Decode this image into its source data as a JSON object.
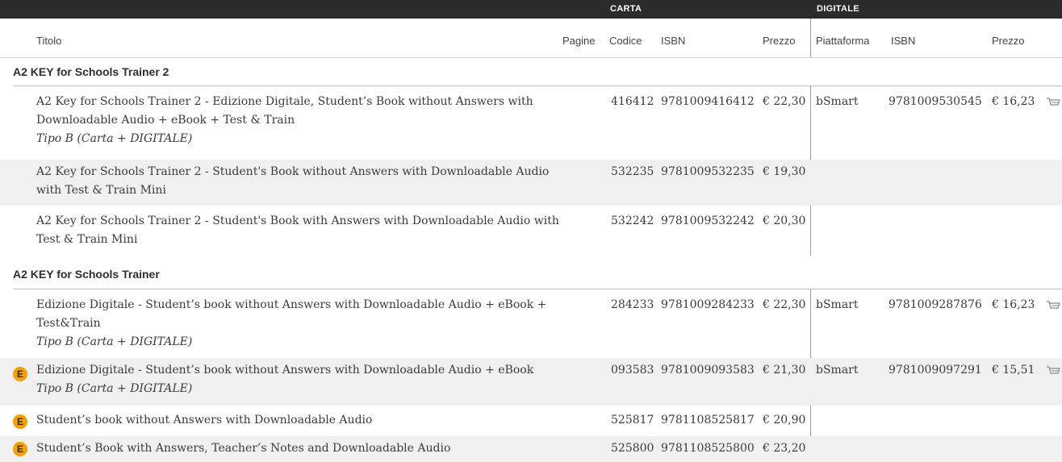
{
  "topbar": {
    "carta": "CARTA",
    "digitale": "DIGITALE"
  },
  "columns": {
    "titolo": "Titolo",
    "pagine": "Pagine",
    "codice": "Codice",
    "isbn": "ISBN",
    "prezzo": "Prezzo",
    "piattaforma": "Piattaforma",
    "d_isbn": "ISBN",
    "d_prezzo": "Prezzo"
  },
  "groups": [
    {
      "title": "A2 KEY for Schools Trainer 2",
      "rows": [
        {
          "title": "A2 Key for Schools Trainer 2 - Edizione Digitale, Student’s Book without Answers with Downloadable Audio + eBook + Test & Train",
          "tipo": "Tipo B (Carta + DIGITALE)",
          "codice": "416412",
          "isbn": "9781009416412",
          "prezzo": "€ 22,30",
          "piattaforma": "bSmart",
          "d_isbn": "9781009530545",
          "d_prezzo": "€ 16,23",
          "badge": ""
        },
        {
          "title": "A2 Key for Schools Trainer 2 - Student's Book without Answers with Downloadable Audio with Test & Train Mini",
          "tipo": "",
          "codice": "532235",
          "isbn": "9781009532235",
          "prezzo": "€ 19,30",
          "piattaforma": "",
          "d_isbn": "",
          "d_prezzo": "",
          "badge": ""
        },
        {
          "title": "A2 Key for Schools Trainer 2 - Student's Book with Answers with Downloadable Audio with Test & Train Mini",
          "tipo": "",
          "codice": "532242",
          "isbn": "9781009532242",
          "prezzo": "€ 20,30",
          "piattaforma": "",
          "d_isbn": "",
          "d_prezzo": "",
          "badge": ""
        }
      ]
    },
    {
      "title": "A2 KEY for Schools Trainer",
      "rows": [
        {
          "title": "Edizione Digitale - Student’s book without Answers with Downloadable Audio + eBook + Test&Train",
          "tipo": "Tipo B (Carta + DIGITALE)",
          "codice": "284233",
          "isbn": "9781009284233",
          "prezzo": "€ 22,30",
          "piattaforma": "bSmart",
          "d_isbn": "9781009287876",
          "d_prezzo": "€ 16,23",
          "badge": ""
        },
        {
          "title": "Edizione Digitale - Student’s book without Answers with Downloadable Audio + eBook",
          "tipo": "Tipo B (Carta + DIGITALE)",
          "codice": "093583",
          "isbn": "9781009093583",
          "prezzo": "€ 21,30",
          "piattaforma": "bSmart",
          "d_isbn": "9781009097291",
          "d_prezzo": "€ 15,51",
          "badge": "E"
        },
        {
          "title": "Student’s book without Answers with Downloadable Audio",
          "tipo": "",
          "codice": "525817",
          "isbn": "9781108525817",
          "prezzo": "€ 20,90",
          "piattaforma": "",
          "d_isbn": "",
          "d_prezzo": "",
          "badge": "E"
        },
        {
          "title": "Student’s Book with Answers, Teacher’s Notes and Downloadable Audio",
          "tipo": "",
          "codice": "525800",
          "isbn": "9781108525800",
          "prezzo": "€ 23,20",
          "piattaforma": "",
          "d_isbn": "",
          "d_prezzo": "",
          "badge": "E"
        }
      ]
    }
  ],
  "colors": {
    "topbar": "#2b2b2b",
    "alt_row": "#f0f0f0",
    "badge": "#f5a000"
  },
  "icons": {
    "cart": "cart-icon",
    "ebook_badge": "ebook-badge"
  }
}
